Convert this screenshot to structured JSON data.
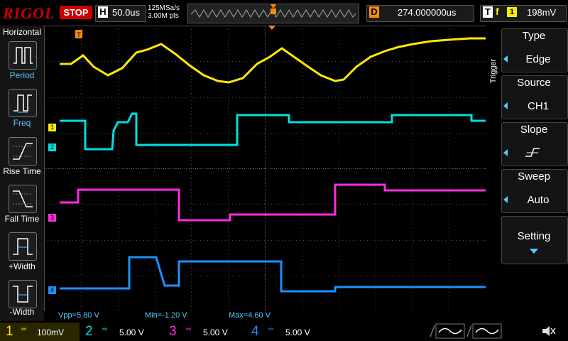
{
  "header": {
    "brand": "RIGOL",
    "run_state": "STOP",
    "timebase_letter": "H",
    "timebase": "50.0us",
    "sample_rate": "125MSa/s",
    "memory_depth": "3.00M pts",
    "delay_letter": "D",
    "delay": "274.000000us",
    "trigger_letter": "T",
    "trigger_slope": "f",
    "trigger_source_num": "1",
    "trigger_level": "198mV"
  },
  "left_menu": {
    "title": "Horizontal",
    "items": [
      {
        "label": "Period",
        "icon": "period-icon"
      },
      {
        "label": "Freq",
        "icon": "frequency-icon"
      },
      {
        "label": "Rise Time",
        "icon": "rise-time-icon"
      },
      {
        "label": "Fall Time",
        "icon": "fall-time-icon"
      },
      {
        "label": "+Width",
        "icon": "positive-width-icon"
      },
      {
        "label": "-Width",
        "icon": "negative-width-icon"
      }
    ]
  },
  "right_menu": {
    "side_label": "Trigger",
    "type_title": "Type",
    "type_value": "Edge",
    "source_title": "Source",
    "source_value": "CH1",
    "slope_title": "Slope",
    "slope_icon": "rising-edge-icon",
    "sweep_title": "Sweep",
    "sweep_value": "Auto",
    "setting_label": "Setting"
  },
  "measurements": {
    "vpp": "Vpp=5.80 V",
    "min": "Min=-1.20 V",
    "max": "Max=4.60 V"
  },
  "channel_markers": [
    "1",
    "2",
    "3",
    "4"
  ],
  "channels": [
    {
      "num": "1",
      "scale": "100mV",
      "color": "#ffea00"
    },
    {
      "num": "2",
      "scale": "5.00 V",
      "color": "#00e0e0"
    },
    {
      "num": "3",
      "scale": "5.00 V",
      "color": "#ff2ee0"
    },
    {
      "num": "4",
      "scale": "5.00 V",
      "color": "#1e90ff"
    }
  ],
  "colors": {
    "ch1": "#ffea00",
    "ch2": "#00e0e0",
    "ch3": "#ff2ee0",
    "ch4": "#1e90ff",
    "trigger_marker": "#fb8b00",
    "stop_badge": "#cc0000",
    "menu_accent": "#5ac8ff"
  }
}
